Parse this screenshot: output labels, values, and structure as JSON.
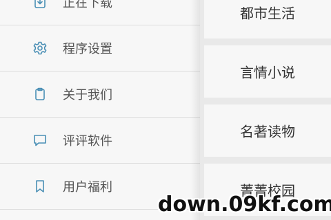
{
  "drawer": {
    "items": [
      {
        "label": "正在下载",
        "icon": "download-icon"
      },
      {
        "label": "程序设置",
        "icon": "gear-icon"
      },
      {
        "label": "关于我们",
        "icon": "clipboard-icon"
      },
      {
        "label": "评评软件",
        "icon": "comment-icon"
      },
      {
        "label": "用户福利",
        "icon": "bookmark-icon"
      }
    ]
  },
  "categories": [
    {
      "label": "都市生活"
    },
    {
      "label": "言情小说"
    },
    {
      "label": "名著读物"
    },
    {
      "label": "菁菁校园"
    }
  ],
  "watermark": "down.09kf.com",
  "colors": {
    "icon": "#4a8fb5",
    "text": "#555555",
    "divider": "#dddddd"
  }
}
